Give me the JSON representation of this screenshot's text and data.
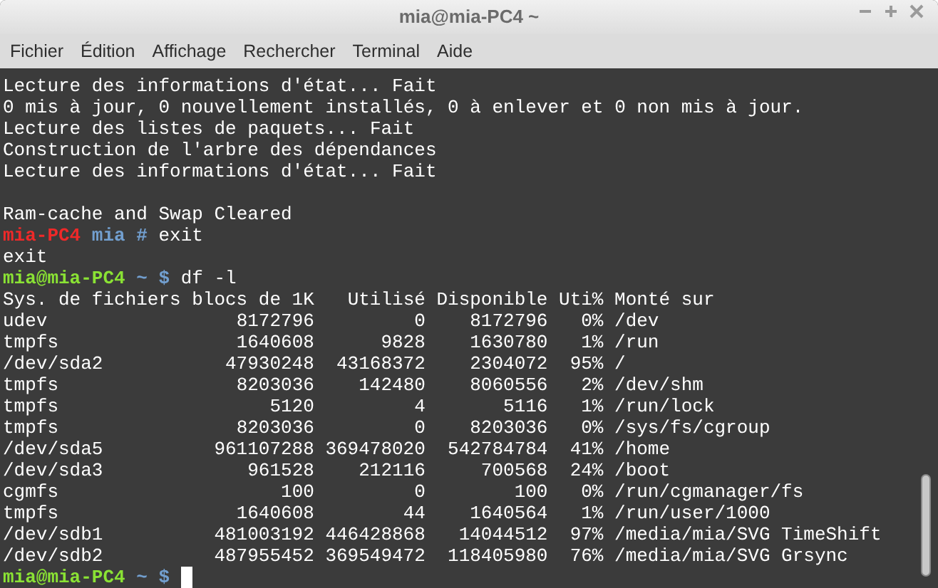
{
  "window": {
    "title": "mia@mia-PC4 ~"
  },
  "menu": [
    "Fichier",
    "Édition",
    "Affichage",
    "Rechercher",
    "Terminal",
    "Aide"
  ],
  "lines": [
    {
      "kind": "text",
      "text": "Lecture des informations d'état... Fait"
    },
    {
      "kind": "text",
      "text": "0 mis à jour, 0 nouvellement installés, 0 à enlever et 0 non mis à jour."
    },
    {
      "kind": "text",
      "text": "Lecture des listes de paquets... Fait"
    },
    {
      "kind": "text",
      "text": "Construction de l'arbre des dépendances"
    },
    {
      "kind": "text",
      "text": "Lecture des informations d'état... Fait"
    },
    {
      "kind": "blank"
    },
    {
      "kind": "text",
      "text": "Ram-cache and Swap Cleared"
    },
    {
      "kind": "root_prompt",
      "host": "mia-PC4",
      "path": "mia",
      "symbol": "#",
      "command": "exit"
    },
    {
      "kind": "text",
      "text": "exit"
    },
    {
      "kind": "prompt",
      "host": "mia@mia-PC4",
      "path": "~",
      "symbol": "$",
      "command": "df -l"
    },
    {
      "kind": "table",
      "columns": [
        "Sys. de fichiers",
        "blocs de 1K",
        "Utilisé",
        "Disponible",
        "Uti%",
        "Monté sur"
      ],
      "rows": [
        [
          "udev",
          "8172796",
          "0",
          "8172796",
          "0%",
          "/dev"
        ],
        [
          "tmpfs",
          "1640608",
          "9828",
          "1630780",
          "1%",
          "/run"
        ],
        [
          "/dev/sda2",
          "47930248",
          "43168372",
          "2304072",
          "95%",
          "/"
        ],
        [
          "tmpfs",
          "8203036",
          "142480",
          "8060556",
          "2%",
          "/dev/shm"
        ],
        [
          "tmpfs",
          "5120",
          "4",
          "5116",
          "1%",
          "/run/lock"
        ],
        [
          "tmpfs",
          "8203036",
          "0",
          "8203036",
          "0%",
          "/sys/fs/cgroup"
        ],
        [
          "/dev/sda5",
          "961107288",
          "369478020",
          "542784784",
          "41%",
          "/home"
        ],
        [
          "/dev/sda3",
          "961528",
          "212116",
          "700568",
          "24%",
          "/boot"
        ],
        [
          "cgmfs",
          "100",
          "0",
          "100",
          "0%",
          "/run/cgmanager/fs"
        ],
        [
          "tmpfs",
          "1640608",
          "44",
          "1640564",
          "1%",
          "/run/user/1000"
        ],
        [
          "/dev/sdb1",
          "481003192",
          "446428868",
          "14044512",
          "97%",
          "/media/mia/SVG TimeShift"
        ],
        [
          "/dev/sdb2",
          "487955452",
          "369549472",
          "118405980",
          "76%",
          "/media/mia/SVG Grsync"
        ]
      ]
    },
    {
      "kind": "prompt",
      "host": "mia@mia-PC4",
      "path": "~",
      "symbol": "$",
      "cursor": true
    }
  ]
}
